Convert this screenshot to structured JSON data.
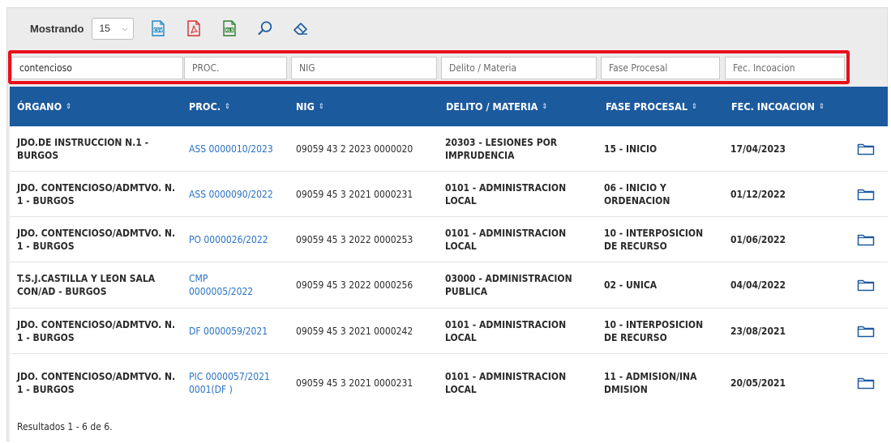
{
  "toolbar": {
    "showing_label": "Mostrando",
    "page_size": "15",
    "icons": [
      "csv-export-icon",
      "pdf-export-icon",
      "xls-export-icon",
      "search-icon",
      "eraser-icon"
    ]
  },
  "filters": {
    "organo": {
      "value": "contencioso",
      "placeholder": ""
    },
    "proc": {
      "value": "",
      "placeholder": "PROC."
    },
    "nig": {
      "value": "",
      "placeholder": "NIG"
    },
    "delito": {
      "value": "",
      "placeholder": "Delito / Materia"
    },
    "fase": {
      "value": "",
      "placeholder": "Fase Procesal"
    },
    "fecha": {
      "value": "",
      "placeholder": "Fec. Incoacion"
    }
  },
  "columns": {
    "organo": "ÓRGANO",
    "proc": "PROC.",
    "nig": "NIG",
    "delito": "DELITO / MATERIA",
    "fase": "FASE PROCESAL",
    "fecha": "FEC. INCOACION",
    "sort_glyph": "⇕"
  },
  "rows": [
    {
      "organo": "JDO.DE INSTRUCCION N.1 - BURGOS",
      "proc": "ASS 0000010/2023",
      "nig": "09059 43 2 2023 0000020",
      "delito": "20303 - LESIONES POR IMPRUDENCIA",
      "fase": "15 - INICIO",
      "fecha": "17/04/2023"
    },
    {
      "organo": "JDO. CONTENCIOSO/ADMTVO. N. 1 - BURGOS",
      "proc": "ASS 0000090/2022",
      "nig": "09059 45 3 2021 0000231",
      "delito": "0101 - ADMINISTRACION LOCAL",
      "fase": "06 - INICIO Y ORDENACION",
      "fecha": "01/12/2022"
    },
    {
      "organo": "JDO. CONTENCIOSO/ADMTVO. N. 1 - BURGOS",
      "proc": "PO 0000026/2022",
      "nig": "09059 45 3 2022 0000253",
      "delito": "0101 - ADMINISTRACION LOCAL",
      "fase": "10 - INTERPOSICION DE RECURSO",
      "fecha": "01/06/2022"
    },
    {
      "organo": "T.S.J.CASTILLA Y LEON SALA CON/AD - BURGOS",
      "proc": "CMP 0000005/2022",
      "nig": "09059 45 3 2022 0000256",
      "delito": "03000 - ADMINISTRACION PUBLICA",
      "fase": "02 - UNICA",
      "fecha": "04/04/2022"
    },
    {
      "organo": "JDO. CONTENCIOSO/ADMTVO. N. 1 - BURGOS",
      "proc": "DF 0000059/2021",
      "nig": "09059 45 3 2021 0000242",
      "delito": "0101 - ADMINISTRACION LOCAL",
      "fase": "10 - INTERPOSICION DE RECURSO",
      "fecha": "23/08/2021"
    },
    {
      "organo": "JDO. CONTENCIOSO/ADMTVO. N. 1 - BURGOS",
      "proc": "PIC 0000057/2021 0001(DF )",
      "nig": "09059 45 3 2021 0000231",
      "delito": "0101 - ADMINISTRACION LOCAL",
      "fase": "11 - ADMISION/INADMISION",
      "fecha": "20/05/2021"
    }
  ],
  "footer": {
    "results": "Resultados 1 - 6 de 6."
  },
  "colors": {
    "header_bg": "#1c5a9e",
    "link": "#2a72c4",
    "highlight": "#e8101a",
    "csv": "#1e88c8",
    "pdf": "#d32f2f",
    "xls": "#2e7d32"
  }
}
